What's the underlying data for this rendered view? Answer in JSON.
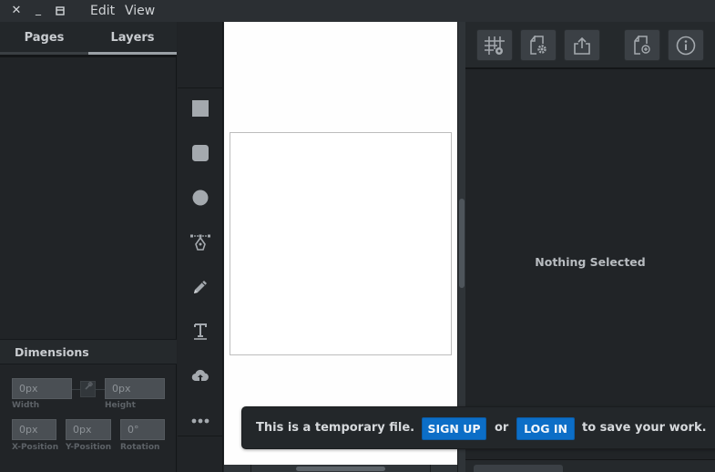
{
  "titlebar": {
    "window_buttons": [
      {
        "icon": "close-icon",
        "glyph": "✕"
      },
      {
        "icon": "minimize-icon",
        "glyph": "_"
      },
      {
        "icon": "maximize-icon",
        "glyph": "▭"
      }
    ],
    "menus": [
      "Edit",
      "View"
    ]
  },
  "left_panel": {
    "tabs": [
      {
        "label": "Pages",
        "active": false
      },
      {
        "label": "Layers",
        "active": true
      }
    ],
    "dimensions": {
      "title": "Dimensions",
      "width": {
        "value": "0px",
        "label": "Width"
      },
      "height": {
        "value": "0px",
        "label": "Height"
      },
      "x_position": {
        "value": "0px",
        "label": "X-Position"
      },
      "y_position": {
        "value": "0px",
        "label": "Y-Position"
      },
      "rotation": {
        "value": "0°",
        "label": "Rotation"
      },
      "lock_ratio_icon": "link-icon"
    }
  },
  "toolbar": {
    "tools": [
      {
        "name": "rectangle-tool",
        "icon": "rectangle-icon"
      },
      {
        "name": "rounded-rectangle-tool",
        "icon": "rounded-rectangle-icon"
      },
      {
        "name": "ellipse-tool",
        "icon": "ellipse-icon"
      },
      {
        "name": "pen-tool",
        "icon": "pen-icon"
      },
      {
        "name": "pencil-tool",
        "icon": "pencil-icon"
      },
      {
        "name": "text-tool",
        "icon": "text-icon"
      },
      {
        "name": "upload-tool",
        "icon": "cloud-upload-icon"
      },
      {
        "name": "more-tools",
        "icon": "more-icon"
      }
    ]
  },
  "right_panel": {
    "buttons": [
      {
        "name": "grid-settings-button",
        "icon": "grid-icon"
      },
      {
        "name": "document-settings-button",
        "icon": "document-gear-icon"
      },
      {
        "name": "export-button",
        "icon": "share-icon"
      },
      {
        "name": "new-page-button",
        "icon": "document-add-icon"
      },
      {
        "name": "info-button",
        "icon": "info-icon"
      }
    ],
    "empty_state": "Nothing Selected"
  },
  "toast": {
    "message_start": "This is a temporary file.",
    "signup_label": "SIGN UP",
    "or_text": "or",
    "login_label": "LOG IN",
    "message_end": "to save your work.",
    "accent_color": "#0c6ec7"
  }
}
